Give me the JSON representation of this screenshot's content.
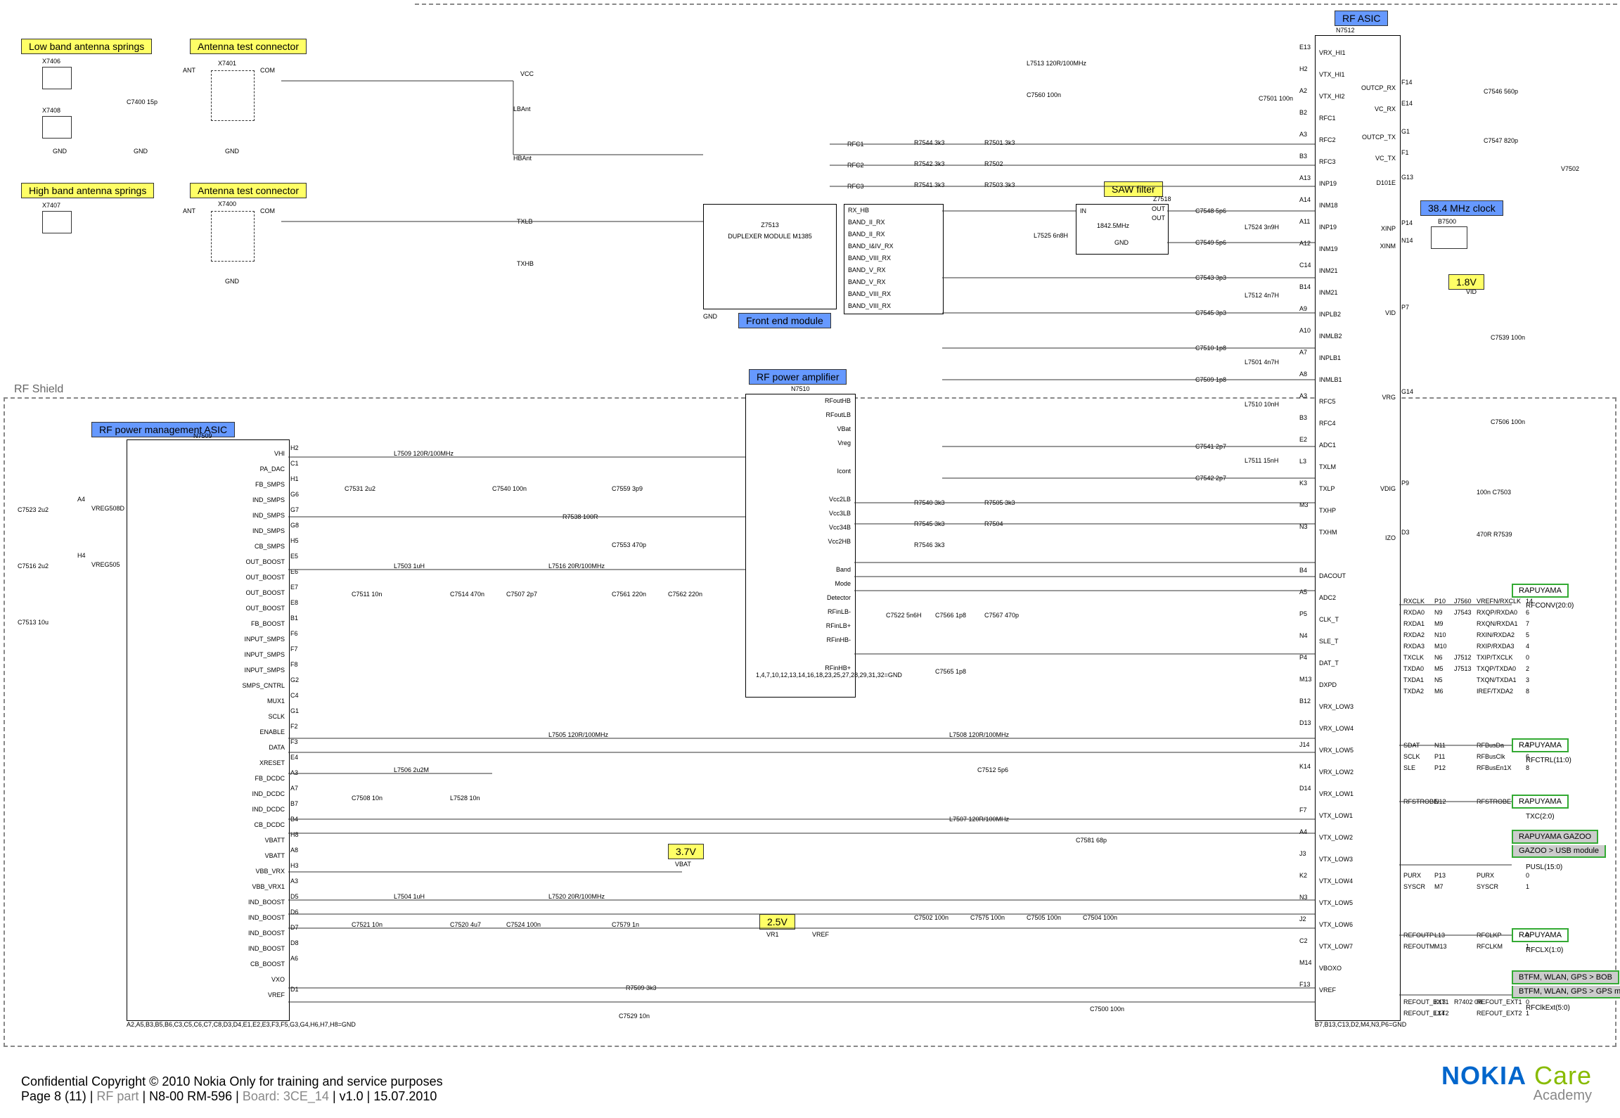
{
  "labels": {
    "low_band_springs": "Low band antenna springs",
    "ant_test_conn1": "Antenna test connector",
    "high_band_springs": "High band antenna springs",
    "ant_test_conn2": "Antenna test connector",
    "rf_pm_asic": "RF power management ASIC",
    "rf_pa": "RF power amplifier",
    "front_end": "Front end module",
    "saw": "SAW filter",
    "rf_asic": "RF ASIC",
    "clk_384": "38.4 MHz clock",
    "v3p7": "3.7V",
    "v2p5": "2.5V",
    "v1p8": "1.8V",
    "rf_shield": "RF Shield"
  },
  "duplexer": {
    "ref": "Z7513",
    "name": "DUPLEXER MODULE M1385"
  },
  "rf_asic": {
    "ref": "N7512"
  },
  "rf_pa": {
    "ref": "N7510"
  },
  "rf_pm": {
    "ref": "N7509"
  },
  "saw": {
    "ref": "Z7518",
    "freq": "1842.5MHz"
  },
  "rx_bands": [
    "RX_HB",
    "BAND_II_RX",
    "BAND_II_RX",
    "BAND_I&IV_RX",
    "BAND_VIII_RX",
    "BAND_V_RX",
    "BAND_V_RX",
    "BAND_VIII_RX",
    "BAND_VIII_RX"
  ],
  "rf_pa_pins_right": [
    "RFoutHB",
    "RFoutLB",
    "VBat",
    "Vreg",
    "",
    "Icont",
    "",
    "Vcc2LB",
    "Vcc3LB",
    "Vcc34B",
    "Vcc2HB",
    "",
    "Band",
    "Mode",
    "Detector",
    "RFinLB-",
    "RFinLB+",
    "RFinHB-",
    "",
    "RFinHB+"
  ],
  "rf_asic_left_pins": [
    {
      "n": "E13",
      "l": "VRX_HI1"
    },
    {
      "n": "H2",
      "l": "VTX_HI1"
    },
    {
      "n": "A2",
      "l": "VTX_HI2"
    },
    {
      "n": "B2",
      "l": "RFC1"
    },
    {
      "n": "A3",
      "l": "RFC2"
    },
    {
      "n": "B3",
      "l": "RFC3"
    },
    {
      "n": "A13",
      "l": "INP19"
    },
    {
      "n": "A14",
      "l": "INM18"
    },
    {
      "n": "A11",
      "l": "INP19"
    },
    {
      "n": "A12",
      "l": "INM19"
    },
    {
      "n": "C14",
      "l": "INM21"
    },
    {
      "n": "B14",
      "l": "INM21"
    },
    {
      "n": "A9",
      "l": "INPLB2"
    },
    {
      "n": "A10",
      "l": "INMLB2"
    },
    {
      "n": "A7",
      "l": "INPLB1"
    },
    {
      "n": "A8",
      "l": "INMLB1"
    },
    {
      "n": "A3",
      "l": "RFC5"
    },
    {
      "n": "B3",
      "l": "RFC4"
    },
    {
      "n": "E2",
      "l": "ADC1"
    },
    {
      "n": "L3",
      "l": "TXLM"
    },
    {
      "n": "K3",
      "l": "TXLP"
    },
    {
      "n": "M3",
      "l": "TXHP"
    },
    {
      "n": "N3",
      "l": "TXHM"
    },
    {
      "n": "",
      "l": ""
    },
    {
      "n": "B4",
      "l": "DACOUT"
    },
    {
      "n": "A5",
      "l": "ADC2"
    },
    {
      "n": "P5",
      "l": "CLK_T"
    },
    {
      "n": "N4",
      "l": "SLE_T"
    },
    {
      "n": "P4",
      "l": "DAT_T"
    },
    {
      "n": "M13",
      "l": "DXPD"
    },
    {
      "n": "B12",
      "l": "VRX_LOW3"
    },
    {
      "n": "D13",
      "l": "VRX_LOW4"
    },
    {
      "n": "J14",
      "l": "VRX_LOW5"
    },
    {
      "n": "K14",
      "l": "VRX_LOW2"
    },
    {
      "n": "D14",
      "l": "VRX_LOW1"
    },
    {
      "n": "F7",
      "l": "VTX_LOW1"
    },
    {
      "n": "A4",
      "l": "VTX_LOW2"
    },
    {
      "n": "J3",
      "l": "VTX_LOW3"
    },
    {
      "n": "K2",
      "l": "VTX_LOW4"
    },
    {
      "n": "N3",
      "l": "VTX_LOW5"
    },
    {
      "n": "J2",
      "l": "VTX_LOW6"
    },
    {
      "n": "C2",
      "l": "VTX_LOW7"
    },
    {
      "n": "M14",
      "l": "VBOXO"
    },
    {
      "n": "F13",
      "l": "VREF"
    }
  ],
  "rf_asic_right_pins": [
    {
      "n": "F14",
      "l": "OUTCP_RX"
    },
    {
      "n": "E14",
      "l": "VC_RX"
    },
    {
      "n": "G1",
      "l": "OUTCP_TX"
    },
    {
      "n": "F1",
      "l": "VC_TX"
    },
    {
      "n": "G13",
      "l": "D101E"
    },
    {
      "n": "P14",
      "l": "XINP"
    },
    {
      "n": "N14",
      "l": "XINM"
    },
    {
      "n": "P7",
      "l": "VID"
    },
    {
      "n": "G14",
      "l": "VRG"
    },
    {
      "n": "P9",
      "l": "VDIG"
    },
    {
      "n": "D3",
      "l": "IZO"
    }
  ],
  "rf_pm_left_pins": [
    {
      "n": "H2",
      "l": "VHI"
    },
    {
      "n": "C1",
      "l": "PA_DAC"
    },
    {
      "n": "H1",
      "l": "FB_SMPS"
    },
    {
      "n": "G6",
      "l": "IND_SMPS"
    },
    {
      "n": "G7",
      "l": "IND_SMPS"
    },
    {
      "n": "G8",
      "l": "IND_SMPS"
    },
    {
      "n": "H5",
      "l": "CB_SMPS"
    },
    {
      "n": "E5",
      "l": "OUT_BOOST"
    },
    {
      "n": "E6",
      "l": "OUT_BOOST"
    },
    {
      "n": "E7",
      "l": "OUT_BOOST"
    },
    {
      "n": "E8",
      "l": "OUT_BOOST"
    },
    {
      "n": "B1",
      "l": "FB_BOOST"
    },
    {
      "n": "F6",
      "l": "INPUT_SMPS"
    },
    {
      "n": "F7",
      "l": "INPUT_SMPS"
    },
    {
      "n": "F8",
      "l": "INPUT_SMPS"
    },
    {
      "n": "G2",
      "l": "SMPS_CNTRL"
    },
    {
      "n": "C4",
      "l": "MUX1"
    },
    {
      "n": "G1",
      "l": "SCLK"
    },
    {
      "n": "F2",
      "l": "ENABLE"
    },
    {
      "n": "F3",
      "l": "DATA"
    },
    {
      "n": "E4",
      "l": "XRESET"
    },
    {
      "n": "A3",
      "l": "FB_DCDC"
    },
    {
      "n": "A7",
      "l": "IND_DCDC"
    },
    {
      "n": "B7",
      "l": "IND_DCDC"
    },
    {
      "n": "B4",
      "l": "CB_DCDC"
    },
    {
      "n": "H8",
      "l": "VBATT"
    },
    {
      "n": "A8",
      "l": "VBATT"
    },
    {
      "n": "H3",
      "l": "VBB_VRX"
    },
    {
      "n": "A3",
      "l": "VBB_VRX1"
    },
    {
      "n": "D5",
      "l": "IND_BOOST"
    },
    {
      "n": "D6",
      "l": "IND_BOOST"
    },
    {
      "n": "D7",
      "l": "IND_BOOST"
    },
    {
      "n": "D8",
      "l": "IND_BOOST"
    },
    {
      "n": "A6",
      "l": "CB_BOOST"
    },
    {
      "n": "",
      "l": "VXO"
    },
    {
      "n": "D1",
      "l": "VREF"
    }
  ],
  "rf_pm_top_pins": [
    {
      "n": "A4",
      "l": "VREG508D"
    },
    {
      "n": "H4",
      "l": "VREG505"
    }
  ],
  "rapuyama": [
    {
      "title": "RAPUYAMA",
      "sig": "RFCONV(20:0)"
    },
    {
      "title": "RAPUYAMA",
      "sig": "RFCTRL(11:0)"
    },
    {
      "title": "RAPUYAMA",
      "sig": "TXC(2:0)"
    },
    {
      "title": "RAPUYAMA GAZOO",
      "sub": "GAZOO > USB module",
      "sig": "PUSL(15:0)"
    },
    {
      "title": "RAPUYAMA",
      "sig": "RFCLX(1:0)"
    },
    {
      "title": "BTFM, WLAN, GPS > BOB",
      "sub": "BTFM, WLAN, GPS > GPS module",
      "sig": "RFClkExt(5:0)"
    }
  ],
  "right_signals": {
    "rfconv": [
      {
        "l": "RXCLK",
        "n": "P10",
        "p": "J7560",
        "r": "VREFN/RXCLK",
        "i": "14"
      },
      {
        "l": "RXDA0",
        "n": "N9",
        "p": "J7543",
        "r": "RXQP/RXDA0",
        "i": "6"
      },
      {
        "l": "RXDA1",
        "n": "M9",
        "p": "",
        "r": "RXQN/RXDA1",
        "i": "7"
      },
      {
        "l": "RXDA2",
        "n": "N10",
        "p": "",
        "r": "RXIN/RXDA2",
        "i": "5"
      },
      {
        "l": "RXDA3",
        "n": "M10",
        "p": "",
        "r": "RXIP/RXDA3",
        "i": "4"
      },
      {
        "l": "TXCLK",
        "n": "N6",
        "p": "J7512",
        "r": "TXIP/TXCLK",
        "i": "0"
      },
      {
        "l": "TXDA0",
        "n": "M5",
        "p": "J7513",
        "r": "TXQP/TXDA0",
        "i": "2"
      },
      {
        "l": "TXDA1",
        "n": "N5",
        "p": "",
        "r": "TXQN/TXDA1",
        "i": "3"
      },
      {
        "l": "TXDA2",
        "n": "M6",
        "p": "",
        "r": "IREF/TXDA2",
        "i": "8"
      }
    ],
    "rfctrl": [
      {
        "l": "SDAT",
        "n": "N11",
        "r": "RFBusDa",
        "i": "7"
      },
      {
        "l": "SCLK",
        "n": "P11",
        "r": "RFBusClk",
        "i": "6"
      },
      {
        "l": "SLE",
        "n": "P12",
        "r": "RFBusEn1X",
        "i": "8"
      }
    ],
    "txc": [
      {
        "l": "RFSTROBE",
        "n": "N12",
        "r": "RFSTROBE",
        "i": ""
      }
    ],
    "pusl": [
      {
        "l": "PURX",
        "n": "P13",
        "r": "PURX",
        "i": "0"
      },
      {
        "l": "SYSCR",
        "n": "M7",
        "r": "SYSCR",
        "i": "1"
      }
    ],
    "rfclx": [
      {
        "l": "REFOUTP",
        "n": "L13",
        "r": "RFCLKP",
        "i": "0"
      },
      {
        "l": "REFOUTM",
        "n": "M13",
        "r": "RFCLKM",
        "i": "1"
      }
    ],
    "rfclkext": [
      {
        "l": "REFOUT_EXT1",
        "n": "K13",
        "p": "R7402 0R",
        "r": "REFOUT_EXT1",
        "i": "0"
      },
      {
        "l": "REFOUT_EXT2",
        "n": "L14",
        "p": "",
        "r": "REFOUT_EXT2",
        "i": "1"
      }
    ]
  },
  "components": {
    "x7406": "X7406",
    "x7408": "X7408",
    "x7401": "X7401",
    "x7407": "X7407",
    "x7400": "X7400",
    "c7400": "C7400 15p",
    "l7513": "L7513 120R/100MHz",
    "c7560": "C7560 100n",
    "c7501": "C7501 100n",
    "r7544": "R7544 3k3",
    "r7542": "R7542 3k3",
    "r7541": "R7541 3k3",
    "r7501": "R7501 3k3",
    "r7502": "R7502",
    "r7503": "R7503 3k3",
    "l7525": "L7525 6n8H",
    "c7548": "C7548 5p6",
    "c7549": "C7549 5p6",
    "l7524": "L7524 3n9H",
    "c7543": "C7543 3p3",
    "l7512": "L7512 4n7H",
    "c7545": "C7545 3p3",
    "c7510": "C7510 1p8",
    "l7501": "L7501 4n7H",
    "c7509": "C7509 1p8",
    "l7510": "L7510 10nH",
    "c7541": "C7541 2p7",
    "l7511": "L7511 15nH",
    "c7542": "C7542 2p7",
    "l7509": "L7509 120R/100MHz",
    "c7531": "C7531 2u2",
    "c7540": "C7540 100n",
    "c7559": "C7559 3p9",
    "r7538": "R7538 100R",
    "c7553": "C7553 470p",
    "l7503": "L7503 1uH",
    "l7516": "L7516 20R/100MHz",
    "c7511": "C7511 10n",
    "c7514": "C7514 470n",
    "c7507": "C7507 2p7",
    "c7561": "C7561 220n",
    "c7562": "C7562 220n",
    "r7540": "R7540 3k3",
    "r7505": "R7505 3k3",
    "r7545": "R7545 3k3",
    "r7504": "R7504",
    "r7546": "R7546 3k3",
    "c7522": "C7522 5n6H",
    "c7566": "C7566 1p8",
    "c7567": "C7567 470p",
    "c7565": "C7565 1p8",
    "l7505": "L7505 120R/100MHz",
    "l7508": "L7508 120R/100MHz",
    "l7506": "L7506 2u2M",
    "c7508": "C7508 10n",
    "l7528": "L7528 10n",
    "l7507": "L7507 120R/100MHz",
    "c7581": "C7581 68p",
    "c7512": "C7512 5p6",
    "l7504": "L7504 1uH",
    "l7520": "L7520 20R/100MHz",
    "c7521": "C7521 10n",
    "c7520": "C7520 4u7",
    "c7524": "C7524 100n",
    "c7579": "C7579 1n",
    "c7502_b": "C7502 100n",
    "c7575": "C7575 100n",
    "c7505_b": "C7505 100n",
    "c7504_b": "C7504 100n",
    "r7509": "R7509 3k3",
    "c7529": "C7529 10n",
    "c7500": "C7500 100n",
    "c7523": "C7523 2u2",
    "c7516": "C7516 2u2",
    "c7513": "C7513 10u",
    "c7546": "C7546 560p",
    "c7547": "C7547 820p",
    "v7502": "V7502",
    "b7500": "B7500",
    "c7539": "C7539 100n",
    "c7506": "C7506 100n",
    "c7503_b": "100n C7503",
    "r7539": "470R R7539",
    "r7402": "R7402 0R",
    "gnd_note_pm": "A2,A5,B3,B5,B6,C3,C5,C6,C7,C8,D3,D4,E1,E2,E3,F3,F5,G3,G4,H6,H7,H8=GND",
    "gnd_note_asic": "B7,B13,C13,D2,M4,N3,P6=GND",
    "pa_gnd_note": "1,4,7,10,12,13,14,16,18,23,25,27,28,29,31,32=GND",
    "vcc": "VCC",
    "lbant": "LBAnt",
    "hbant": "HBAnt",
    "txlb": "TXLB",
    "txhb": "TXHB",
    "rfc1": "RFC1",
    "rfc2": "RFC2",
    "rfc3": "RFC3",
    "ant": "ANT",
    "com": "COM",
    "gnd": "GND",
    "vbat": "VBAT",
    "vr1": "VR1",
    "vref": "VREF",
    "vid": "VID"
  },
  "footer": {
    "line1": "Confidential Copyright © 2010 Nokia Only for training and service purposes",
    "page": "Page 8 (11)",
    "sep": "  |  ",
    "rf_part": "RF part",
    "model": "N8-00 RM-596",
    "board": "Board: 3CE_14",
    "ver": "v1.0",
    "date": "15.07.2010",
    "nokia": "NOKIA",
    "care": " Care",
    "academy": "Academy"
  }
}
